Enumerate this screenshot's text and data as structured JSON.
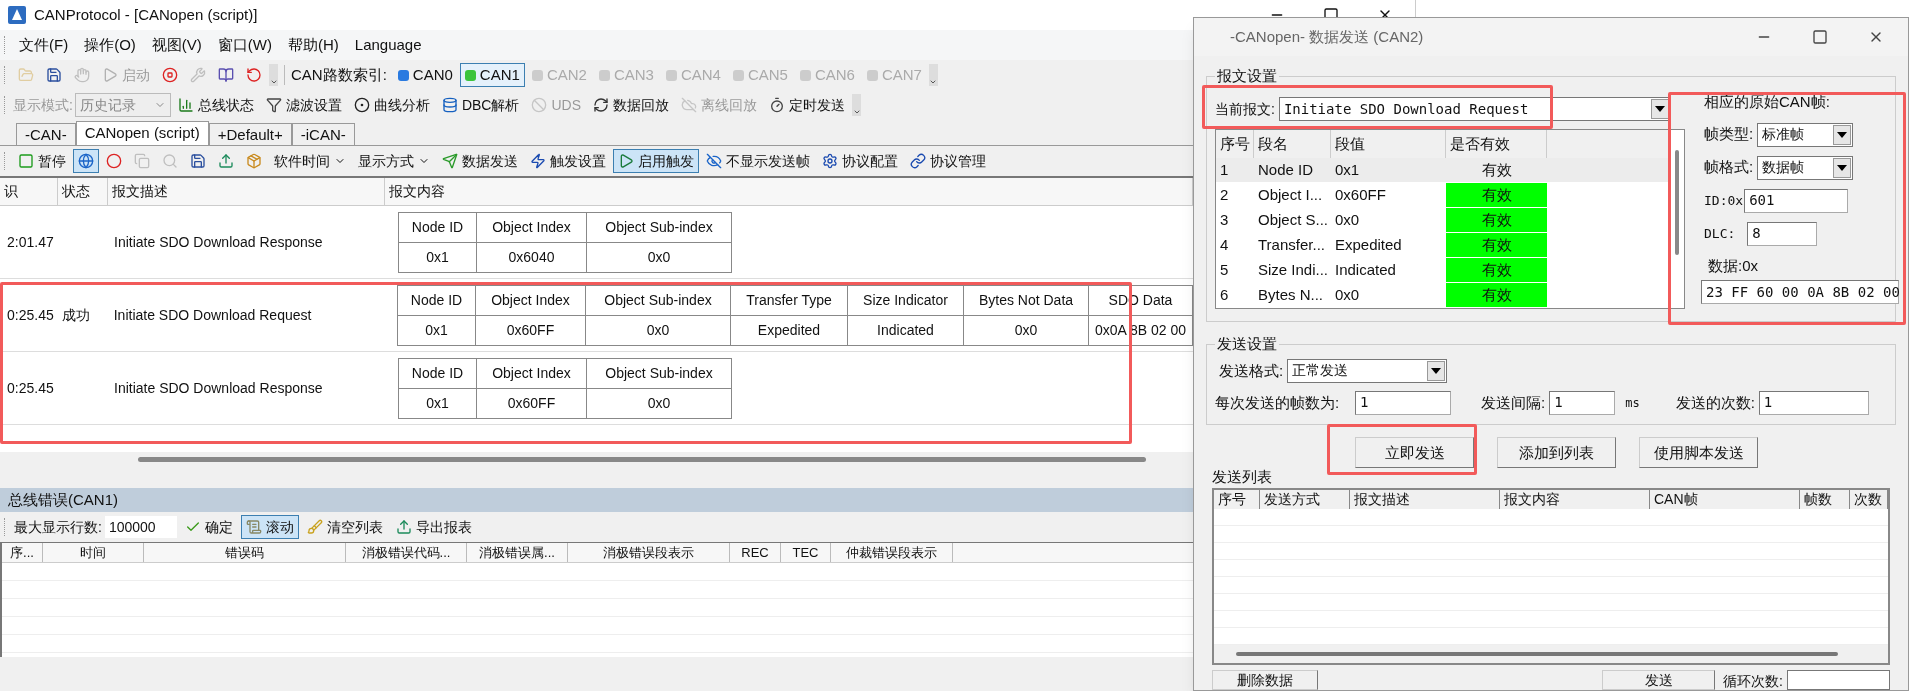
{
  "main_window": {
    "title": "CANProtocol - [CANopen (script)]"
  },
  "menu": [
    "文件(F)",
    "操作(O)",
    "视图(V)",
    "窗口(W)",
    "帮助(H)",
    "Language"
  ],
  "toolbar_1": {
    "tools": [
      {
        "kind": "open",
        "disabled": true
      },
      {
        "kind": "save",
        "disabled": false
      },
      {
        "kind": "hand",
        "disabled": true
      },
      {
        "kind": "start",
        "label": "启动",
        "disabled": true
      },
      {
        "kind": "stop",
        "disabled": false
      },
      {
        "kind": "wrench",
        "disabled": true
      },
      {
        "kind": "book",
        "disabled": false
      },
      {
        "kind": "reset",
        "disabled": false
      }
    ],
    "channel_label": "CAN路数索引:",
    "channels": [
      {
        "label": "CAN0",
        "selected": false,
        "disabled": false
      },
      {
        "label": "CAN1",
        "selected": true,
        "disabled": false
      },
      {
        "label": "CAN2",
        "selected": false,
        "disabled": true
      },
      {
        "label": "CAN3",
        "selected": false,
        "disabled": true
      },
      {
        "label": "CAN4",
        "selected": false,
        "disabled": true
      },
      {
        "label": "CAN5",
        "selected": false,
        "disabled": true
      },
      {
        "label": "CAN6",
        "selected": false,
        "disabled": true
      },
      {
        "label": "CAN7",
        "selected": false,
        "disabled": true
      }
    ]
  },
  "toolbar_2": {
    "mode_label": "显示模式:",
    "mode_value": "历史记录",
    "mode_disabled": true,
    "tools": [
      {
        "kind": "chart",
        "label": "总线状态",
        "disabled": false
      },
      {
        "kind": "filter",
        "label": "滤波设置",
        "disabled": false
      },
      {
        "kind": "curve",
        "label": "曲线分析",
        "disabled": false
      },
      {
        "kind": "dbc",
        "label": "DBC解析",
        "disabled": false
      },
      {
        "kind": "uds",
        "label": "UDS",
        "disabled": true
      },
      {
        "kind": "replay",
        "label": "数据回放",
        "disabled": false
      },
      {
        "kind": "offline",
        "label": "离线回放",
        "disabled": true
      },
      {
        "kind": "timer",
        "label": "定时发送",
        "disabled": false
      }
    ]
  },
  "tabs": [
    {
      "label": "-CAN-",
      "selected": false
    },
    {
      "label": "CANopen (script)",
      "selected": true
    },
    {
      "label": "+Default+",
      "selected": false
    },
    {
      "label": "-iCAN-",
      "selected": false
    }
  ],
  "toolbar_3": {
    "tools": [
      {
        "kind": "pause",
        "label": "暂停",
        "pressed": false,
        "disabled": false
      },
      {
        "kind": "globe",
        "pressed": true,
        "disabled": false
      },
      {
        "kind": "record",
        "pressed": false,
        "disabled": false
      },
      {
        "kind": "copy",
        "pressed": false,
        "disabled": true
      },
      {
        "kind": "find",
        "pressed": false,
        "disabled": true
      },
      {
        "kind": "save",
        "pressed": false,
        "disabled": false
      },
      {
        "kind": "export",
        "pressed": false,
        "disabled": false
      },
      {
        "kind": "package",
        "pressed": false,
        "disabled": false
      },
      {
        "kind": "dropdown",
        "label": "软件时间",
        "pressed": false,
        "disabled": false
      },
      {
        "kind": "dropdown",
        "label": "显示方式",
        "pressed": false,
        "disabled": false
      },
      {
        "kind": "send",
        "label": "数据发送",
        "pressed": false,
        "disabled": false
      },
      {
        "kind": "trigger",
        "label": "触发设置",
        "pressed": false,
        "disabled": false
      },
      {
        "kind": "enable",
        "label": "启用触发",
        "pressed": true,
        "disabled": false
      },
      {
        "kind": "hide",
        "label": "不显示发送帧",
        "pressed": false,
        "disabled": false
      },
      {
        "kind": "config",
        "label": "协议配置",
        "pressed": false,
        "disabled": false
      },
      {
        "kind": "manage",
        "label": "协议管理",
        "pressed": false,
        "disabled": false
      }
    ]
  },
  "messages": {
    "columns": [
      "识",
      "状态",
      "报文描述",
      "报文内容"
    ],
    "rows": [
      {
        "time": "2:01.47",
        "description": "Initiate SDO Download Response",
        "fields": [
          {
            "name": "Node ID",
            "value": "0x1"
          },
          {
            "name": "Object Index",
            "value": "0x6040"
          },
          {
            "name": "Object Sub-index",
            "value": "0x0"
          }
        ]
      },
      {
        "time": "0:25.45",
        "status": "成功",
        "description": "Initiate SDO Download Request",
        "fields": [
          {
            "name": "Node ID",
            "value": "0x1"
          },
          {
            "name": "Object Index",
            "value": "0x60FF"
          },
          {
            "name": "Object Sub-index",
            "value": "0x0"
          },
          {
            "name": "Transfer Type",
            "value": "Expedited"
          },
          {
            "name": "Size Indicator",
            "value": "Indicated"
          },
          {
            "name": "Bytes Not Data",
            "value": "0x0"
          },
          {
            "name": "SDO Data",
            "value": "0x0A 8B 02 00"
          }
        ]
      },
      {
        "time": "0:25.45",
        "description": "Initiate SDO Download Response",
        "fields": [
          {
            "name": "Node ID",
            "value": "0x1"
          },
          {
            "name": "Object Index",
            "value": "0x60FF"
          },
          {
            "name": "Object Sub-index",
            "value": "0x0"
          }
        ]
      }
    ]
  },
  "bus_errors": {
    "title": "总线错误(CAN1)",
    "max_rows_label": "最大显示行数:",
    "max_rows_value": "100000",
    "buttons": [
      {
        "kind": "ok",
        "label": "确定",
        "pressed": false
      },
      {
        "kind": "scroll",
        "label": "滚动",
        "pressed": true
      },
      {
        "kind": "clear",
        "label": "清空列表",
        "pressed": false
      },
      {
        "kind": "export",
        "label": "导出报表",
        "pressed": false
      }
    ],
    "columns": [
      "序...",
      "时间",
      "错误码",
      "消极错误代码...",
      "消极错误属...",
      "消极错误段表示",
      "REC",
      "TEC",
      "仲裁错误段表示"
    ]
  },
  "send_dialog": {
    "title": "-CANopen- 数据发送 (CAN2)",
    "message_settings": {
      "title": "报文设置",
      "current_label": "当前报文:",
      "current_value": "Initiate SDO Download Request",
      "columns": [
        "序号",
        "段名",
        "段值",
        "是否有效"
      ],
      "rows": [
        {
          "index": "1",
          "name": "Node ID",
          "value": "0x1",
          "validity": "有效",
          "selected": true
        },
        {
          "index": "2",
          "name": "Object I...",
          "value": "0x60FF",
          "validity": "有效",
          "selected": false
        },
        {
          "index": "3",
          "name": "Object S...",
          "value": "0x0",
          "validity": "有效",
          "selected": false
        },
        {
          "index": "4",
          "name": "Transfer...",
          "value": "Expedited",
          "validity": "有效",
          "selected": false
        },
        {
          "index": "5",
          "name": "Size Indi...",
          "value": "Indicated",
          "validity": "有效",
          "selected": false
        },
        {
          "index": "6",
          "name": "Bytes N...",
          "value": "0x0",
          "validity": "有效",
          "selected": false
        }
      ]
    },
    "raw_frame": {
      "title": "相应的原始CAN帧:",
      "frame_type_label": "帧类型:",
      "frame_type": "标准帧",
      "frame_format_label": "帧格式:",
      "frame_format": "数据帧",
      "id_label": "ID:0x",
      "id": "601",
      "dlc_label": "DLC:",
      "dlc": "8",
      "data_label": "数据:0x",
      "data": "23 FF 60 00 0A 8B 02 00"
    },
    "send_settings": {
      "title": "发送设置",
      "format_label": "发送格式:",
      "format": "正常发送",
      "frames_label": "每次发送的帧数为:",
      "frames": "1",
      "interval_label": "发送间隔:",
      "interval": "1",
      "interval_unit": "ms",
      "count_label": "发送的次数:",
      "count": "1"
    },
    "actions": [
      "立即发送",
      "添加到列表",
      "使用脚本发送"
    ],
    "send_list": {
      "title": "发送列表",
      "columns": [
        "序号",
        "发送方式",
        "报文描述",
        "报文内容",
        "CAN帧",
        "帧数",
        "次数"
      ]
    },
    "bottom": {
      "delete": "删除数据",
      "send": "发送",
      "loop_label": "循环次数:"
    }
  }
}
